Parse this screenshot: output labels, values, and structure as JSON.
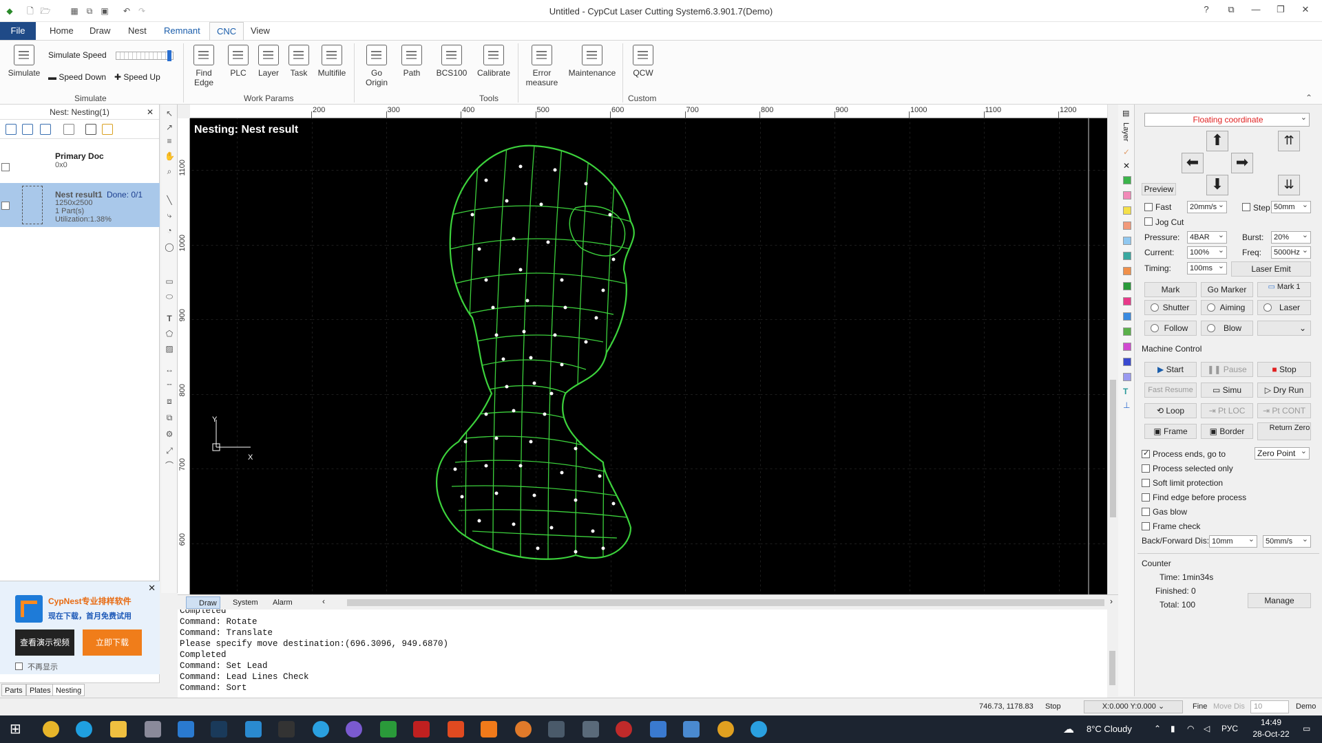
{
  "window": {
    "title": "Untitled - CypCut Laser Cutting System6.3.901.7(Demo)"
  },
  "menu": {
    "tabs": [
      "File",
      "Home",
      "Draw",
      "Nest",
      "Remnant",
      "CNC",
      "View"
    ]
  },
  "ribbon": {
    "simulate": {
      "label": "Simulate",
      "speed_label": "Simulate Speed",
      "speed_down": "Speed Down",
      "speed_up": "Speed Up",
      "group": "Simulate"
    },
    "work_params": [
      "Find Edge",
      "PLC",
      "Layer",
      "Task",
      "Multifile"
    ],
    "work_params_group": "Work Params",
    "tools": [
      "Go Origin",
      "Path",
      "BCS100",
      "Calibrate"
    ],
    "tools_group": "Tools",
    "custom": [
      "Error measure",
      "Maintenance",
      "QCW"
    ],
    "custom_group": "Custom"
  },
  "left_panel": {
    "header": "Nest: Nesting(1)",
    "primary_doc": {
      "name": "Primary Doc",
      "size": "0x0"
    },
    "nest_result": {
      "name": "Nest result1",
      "done": "Done: 0/1",
      "size": "1250x2500",
      "parts": "1 Part(s)",
      "utilization": "Utilization:1.38%"
    },
    "tabs": [
      "Parts",
      "Plates",
      "Nesting"
    ]
  },
  "ad": {
    "title": "CypNest专业排样软件",
    "subtitle": "现在下载，首月免费试用",
    "btn_video": "查看演示视频",
    "btn_download": "立即下载",
    "no_show": "不再显示"
  },
  "canvas": {
    "overlay_title": "Nesting: Nest result",
    "ruler_h": [
      "200",
      "300",
      "400",
      "500",
      "600",
      "700",
      "800",
      "900",
      "1000",
      "1100",
      "1200"
    ],
    "ruler_v": [
      "1100",
      "1000",
      "900",
      "800",
      "700",
      "600"
    ],
    "axis_x": "X",
    "axis_y": "Y"
  },
  "bottom_tabs": [
    "Draw",
    "System",
    "Alarm"
  ],
  "log": [
    "Completed",
    "Command: Rotate",
    "Command: Translate",
    "Please specify move destination:(696.3096, 949.6870)",
    "Completed",
    "Command: Set Lead",
    "Command: Lead Lines Check",
    "Command: Sort"
  ],
  "right_panel": {
    "coord_mode": "Floating coordinate",
    "preview": "Preview",
    "fast_label": "Fast",
    "fast_speed": "20mm/s",
    "step_label": "Step",
    "step_value": "50mm",
    "jog_cut": "Jog Cut",
    "pressure_label": "Pressure:",
    "pressure": "4BAR",
    "burst_label": "Burst:",
    "burst": "20%",
    "current_label": "Current:",
    "current": "100%",
    "freq_label": "Freq:",
    "freq": "5000Hz",
    "timing_label": "Timing:",
    "timing": "100ms",
    "laser_emit": "Laser Emit",
    "mark": "Mark",
    "go_marker": "Go Marker",
    "mark1": "Mark 1",
    "shutter": "Shutter",
    "aiming": "Aiming",
    "laser": "Laser",
    "follow": "Follow",
    "blow": "Blow",
    "machine_control": "Machine Control",
    "start": "Start",
    "pause": "Pause",
    "stop": "Stop",
    "fast_resume": "Fast Resume",
    "simu": "Simu",
    "dry_run": "Dry Run",
    "loop": "Loop",
    "pt_loc": "Pt LOC",
    "pt_cont": "Pt CONT",
    "frame": "Frame",
    "border": "Border",
    "return_zero": "Return Zero",
    "process_ends": "Process ends, go to",
    "zero_point": "Zero Point",
    "process_selected": "Process selected only",
    "soft_limit": "Soft limit protection",
    "find_edge": "Find edge before process",
    "gas_blow": "Gas blow",
    "frame_check": "Frame check",
    "bf_label": "Back/Forward Dis:",
    "bf_dist": "10mm",
    "bf_speed": "50mm/s",
    "counter": "Counter",
    "time": "Time: 1min34s",
    "finished": "Finished: 0",
    "total": "Total: 100",
    "manage": "Manage"
  },
  "status": {
    "coords": "746.73, 1178.83",
    "state": "Stop",
    "xy": "X:0.000 Y:0.000",
    "fine": "Fine",
    "move_dis": "Move Dis",
    "move_val": "10",
    "demo": "Demo"
  },
  "taskbar": {
    "weather": "8°C  Cloudy",
    "lang": "РУС",
    "time": "14:49",
    "date": "28-Oct-22"
  },
  "colors": {
    "accent": "#1f4a87",
    "canvas_bg": "#000000",
    "part_green": "#3cd23c",
    "coord_red": "#e02020"
  }
}
